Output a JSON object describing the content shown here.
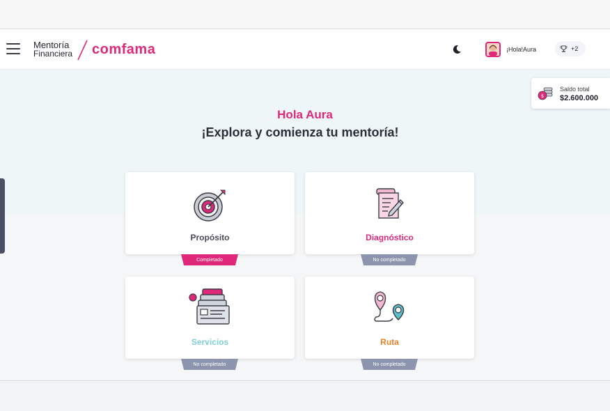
{
  "header": {
    "brand_line1": "Mentoría",
    "brand_line2": "Financiera",
    "logo_text": "comfama",
    "greeting": "¡Hola!Aura",
    "trophy_count": "+2"
  },
  "balance": {
    "label": "Saldo total",
    "value": "$2.600.000"
  },
  "hero": {
    "hello": "Hola Aura",
    "subtitle": "¡Explora y comienza tu mentoría!"
  },
  "cards": [
    {
      "title": "Propósito",
      "status": "Completado",
      "title_color": "#4a4a58",
      "icon": "target-icon"
    },
    {
      "title": "Diagnóstico",
      "status": "No completado",
      "title_color": "#e0287a",
      "icon": "checklist-icon"
    },
    {
      "title": "Servicios",
      "status": "No completado",
      "title_color": "#7fcfd6",
      "icon": "services-icon"
    },
    {
      "title": "Ruta",
      "status": "No completado",
      "title_color": "#e8822a",
      "icon": "route-icon"
    }
  ],
  "colors": {
    "brand": "#e0287a",
    "teal": "#5bc0c8",
    "badge_incomplete": "#8c95ad"
  }
}
